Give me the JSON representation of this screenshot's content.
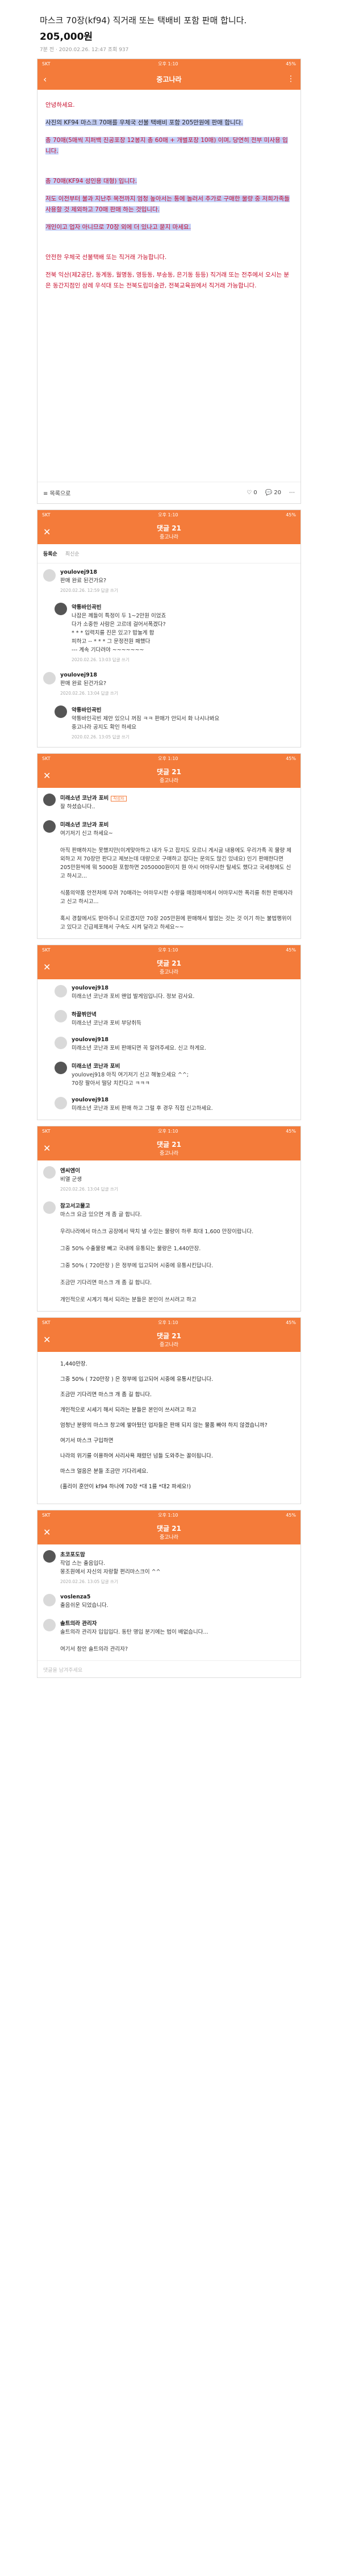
{
  "post": {
    "title": "마스크 70장(kf94) 직거래 또는 택배비 포함 판매 합니다.",
    "price": "205,000원",
    "meta": "7분 전 · 2020.02.26. 12:47 조회 937"
  },
  "statusbar": {
    "left": "SKT",
    "time": "오후 1:10",
    "right": "45%"
  },
  "appbar": {
    "title": "중고나라",
    "back": "‹",
    "more": "⋮"
  },
  "body": {
    "greeting": "안녕하세요.",
    "p1": "사진의 KF94 마스크 70매를 우체국 선불 택배비 포함 205만원에 판매 합니다.",
    "p2": "총 70매(5매씩 지퍼백 진공포장 12봉지 총 60매 + 개별포장 10매) 이며, 당연히 전부 미사용 입니다.",
    "p3": "총 70매(KF94 성인용 대형) 입니다.",
    "p4": "저도 이전부터 불과 지난주 목전까지 엄청 높아서는 통에 놀러서 추가로 구매한 물량 중 저희가족들 사용할 것 제외하고 70매 판매 하는 것입니다.",
    "p5": "개인이고 업자 아니므로 70장 외에 더 있나고 묻지 마세요.",
    "p6": "안전한 우체국 선불택배 또는 직거래 가능합니다.",
    "p7": "전북 익산(제2공단, 동계동, 월명동, 영등동, 부송동, 은기동 등등) 직거래 또는 전주에서 오시는 분은 동간지점인 삼례 우석대 또는 전북도립미술관, 전북교육원에서 직거래 가능합니다."
  },
  "actionbar": {
    "list": "목록으로",
    "likes": "0",
    "comments": "20",
    "like_icon": "heart-icon",
    "comment_icon": "speech-bubble-icon"
  },
  "comment_header": {
    "title": "댓글 21",
    "subtitle": "중고나라"
  },
  "comment_tabs": {
    "first": "등록순",
    "second": "최신순"
  },
  "comments": [
    {
      "name": "youlovej918",
      "badge": "",
      "text": "판매 완료 된건가요?",
      "meta": "2020.02.26. 12:59  답글 쓰기",
      "reply": false
    },
    {
      "name": "약통바인곡빈",
      "badge": "",
      "text": "나잡은 께들이 특정이 두 1~2만원 이었죠\n다가 소중한 사람은 고르데 걸어서폭겠다?\n* * * 입력치를 진은 있고? 밥눌게 합\n피하고 -- * * * 그 문정전원 패했다\n--- 계속 기다려야 ~~~~~~~",
      "meta": "2020.02.26. 13:03  답글 쓰기",
      "reply": true
    },
    {
      "name": "youlovej918",
      "badge": "",
      "text": "판매 완료 된건가요?",
      "meta": "2020.02.26. 13:04  답글 쓰기",
      "reply": false
    },
    {
      "name": "약통바인곡빈",
      "badge": "",
      "text": "약통바인곡빈 제안 있으니 꺼짐 ㅋㅋ 판매가 안되서 화 나시나봐요\n중고나라 공지도 확인 하세요",
      "meta": "2020.02.26. 13:05  답글 쓰기",
      "reply": true
    },
    {
      "name": "미래소년 코난과 포비",
      "badge": "작성자",
      "text": "잘 하셨습니다..",
      "meta": "",
      "reply": false
    },
    {
      "name": "미래소년 코난과 포비",
      "badge": "",
      "text": "여기저기 신고 하세요~\n\n아직 판매하지는 못했지만(이게맞아하고 내가 두고 잡지도 모르니 게시글 내용에도 우리가족 꼭 물량 제외하고 저 70장만 판다고 제보는데 대량으로 구매하고 잡다는 문의도 많긴 있네요) 인기 판매한다면 205만원씩에 뭐 5000원 포함하면 2050000원이지 뭔 아시 어마무시한 탈세도 했다고 국세청에도 신고 하시고...\n\n식품의약품 안전처에 무려 70매라는 어마무시한 수량을 매점매석에서 어마무시한 폭리를 취한 판매자라고 신고 하시고...\n\n혹시 경찰에서도 받아주니 모르겠지만 70장 205만원에 판매해서 벌었는 것는 것 이기 하는 불법행위이고 있다고 긴급제포해서 구속도 시켜 달라고 하세요~~",
      "meta": "",
      "reply": false
    },
    {
      "name": "youlovej918",
      "badge": "",
      "text": "미래소년 코난과 포비 왠업 발게임입니다. 정보 감사요.",
      "meta": "",
      "reply": true
    },
    {
      "name": "하끌뷔안녁",
      "badge": "",
      "text": "미래소년 코난과 포비 부당취득",
      "meta": "",
      "reply": true
    },
    {
      "name": "youlovej918",
      "badge": "",
      "text": "미래소년 코난과 포비 판매되면 꼭 알려주세요. 신고 하게요.",
      "meta": "",
      "reply": true
    },
    {
      "name": "미래소년 코난과 포비",
      "badge": "",
      "text": "youlovej918 아직 여기저기 신고 해놓으세요 ^^;\n70장 팔아서 떨당 치킨다고 ㅋㅋㅋ",
      "meta": "",
      "reply": true
    },
    {
      "name": "youlovej918",
      "badge": "",
      "text": "미래소년 코난과 포비 판매 하고 그럴 후 경우 직접 신고하세요.",
      "meta": "",
      "reply": true
    },
    {
      "name": "엔씨엔이",
      "badge": "",
      "text": "비열 군생",
      "meta": "2020.02.26. 13:04  답글 쓰기",
      "reply": false
    },
    {
      "name": "참고서고물고",
      "badge": "",
      "text": "마스크 요금 있으면 개 좀 글 합니다.\n\n우리나라에서 마스크 공장에서 딱치 낼 수있는 물량이 하루 최대 1,600 만장이랍니다.\n\n그중 50% 수출물량 빼고 국내에 유통되는 물량은 1,440만장.\n\n그중 50% ( 720만장 ) 은 정부에 입고되어 시중에 유통시킨답니다.\n\n조금만 기다리면 마스크 개 좀 길 합니다.\n\n개인적으로 시계기 해서 되라는 분들은 본인이 쓰시려고 하고",
      "meta": "",
      "reply": false
    },
    {
      "name": "초코포도맘",
      "badge": "",
      "text": "작업 스는 출음입다.\n몽조원에서 자신의 자랑할 편리마스크이 ^^",
      "meta": "2020.02.26. 13:05  답글 쓰기",
      "reply": false
    },
    {
      "name": "voslenza5",
      "badge": "",
      "text": "출음쉬운 되었습니다.",
      "meta": "",
      "reply": false
    },
    {
      "name": "솔트의라 관리자",
      "badge": "",
      "text": "솔트의라 관리자 입입입다. 동탄 명입 분기에는 법이 배없습니다...\n\n여기서 참안 솔트의라 관리자?",
      "meta": "",
      "reply": false
    }
  ],
  "continued": {
    "c1": "1,440만장.",
    "c2": "그중 50% ( 720만장 ) 은 정부에 입고되어 시중에 유통시킨답니다.",
    "c3": "조금만 기다리면 마스크 개 좀 길 합니다.",
    "c4": "개인적으로 시세기 해서 되라는 분들은 본인이 쓰시려고 하고",
    "c5": "엄청난 분량의 마스크 창고에 쌓아뒀던 업자들은 판매 되지 않는 물품 빠야 하지 않겠습니까?",
    "c6": "여기서 마스크 구입하면",
    "c7": "나라의 위기를 이용하여 사리사욕 채렸던 넘들 도와주는 꼴이됩니다.",
    "c8": "마스크 얼음은 분들 조금만 기다리세요.",
    "c9": "(홀리이 훈안이 kf94 하나에 70장 *대 1를 *대2 파세요!)"
  },
  "input": {
    "placeholder": "댓글을 남겨주세요"
  }
}
